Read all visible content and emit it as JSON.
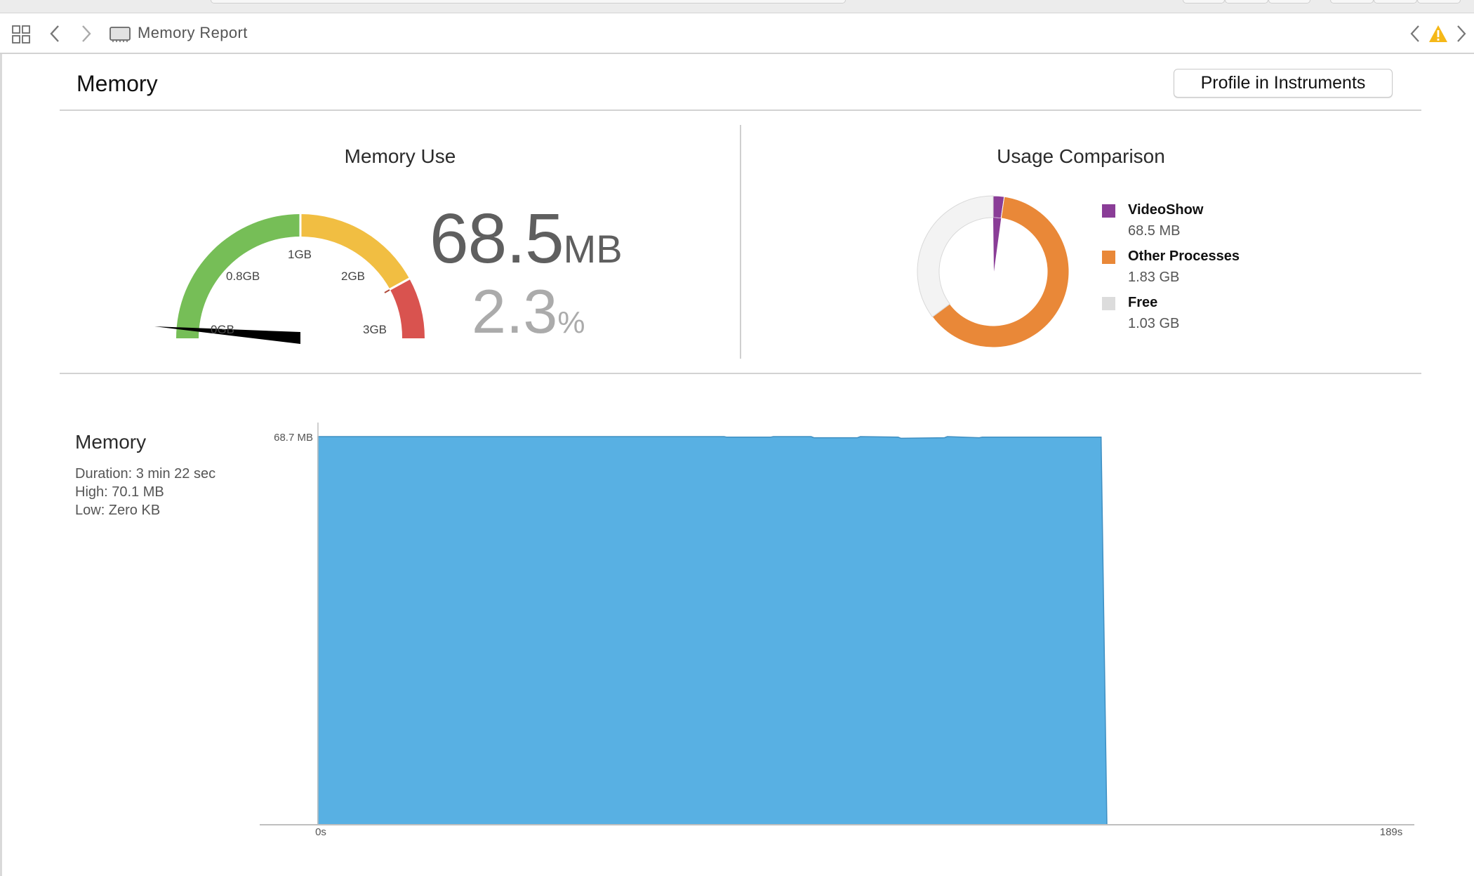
{
  "jump_bar": {
    "title": "Memory Report"
  },
  "header": {
    "title": "Memory",
    "profile_button": "Profile in Instruments"
  },
  "memory_use": {
    "title": "Memory Use",
    "value": "68.5",
    "unit": "MB",
    "percent": "2.3",
    "percent_unit": "%",
    "gauge_labels": [
      "0GB",
      "0.8GB",
      "1GB",
      "2GB",
      "3GB"
    ],
    "colors": {
      "green": "#76be57",
      "yellow": "#f1be42",
      "red": "#d9534f",
      "needle": "#000000"
    }
  },
  "usage_comparison": {
    "title": "Usage Comparison",
    "legend": [
      {
        "name": "VideoShow",
        "value": "68.5 MB",
        "color": "#8a3d97"
      },
      {
        "name": "Other Processes",
        "value": "1.83 GB",
        "color": "#e98838"
      },
      {
        "name": "Free",
        "value": "1.03 GB",
        "color": "#dcdcdc"
      }
    ]
  },
  "timeline": {
    "title": "Memory",
    "duration": "Duration: 3 min 22 sec",
    "high": "High: 70.1 MB",
    "low": "Low: Zero KB",
    "y_label": "68.7 MB",
    "x_start": "0s",
    "x_end": "189s",
    "color": "#58b0e3"
  },
  "chart_data": [
    {
      "type": "pie",
      "title": "Usage Comparison",
      "categories": [
        "VideoShow",
        "Other Processes",
        "Free"
      ],
      "values": [
        68.5,
        1830,
        1030
      ],
      "unit": "MB",
      "colors": [
        "#8a3d97",
        "#e98838",
        "#f3f3f3"
      ],
      "legend": "right"
    },
    {
      "type": "area",
      "title": "Memory",
      "x": [
        0,
        70,
        70.5,
        78,
        78.5,
        85,
        85.5,
        93,
        93.5,
        100,
        100.5,
        108,
        108.5,
        114,
        114.5,
        130,
        135,
        136,
        189
      ],
      "y": [
        68.7,
        68.7,
        68.6,
        68.6,
        68.7,
        68.7,
        68.5,
        68.5,
        68.7,
        68.6,
        68.4,
        68.5,
        68.7,
        68.5,
        68.6,
        68.6,
        68.6,
        0,
        0
      ],
      "xlabel": "",
      "ylabel": "",
      "xlim": [
        0,
        189
      ],
      "x_ticks": [
        "0s",
        "189s"
      ],
      "y_ticks": [
        "68.7 MB"
      ],
      "color": "#58b0e3"
    }
  ]
}
